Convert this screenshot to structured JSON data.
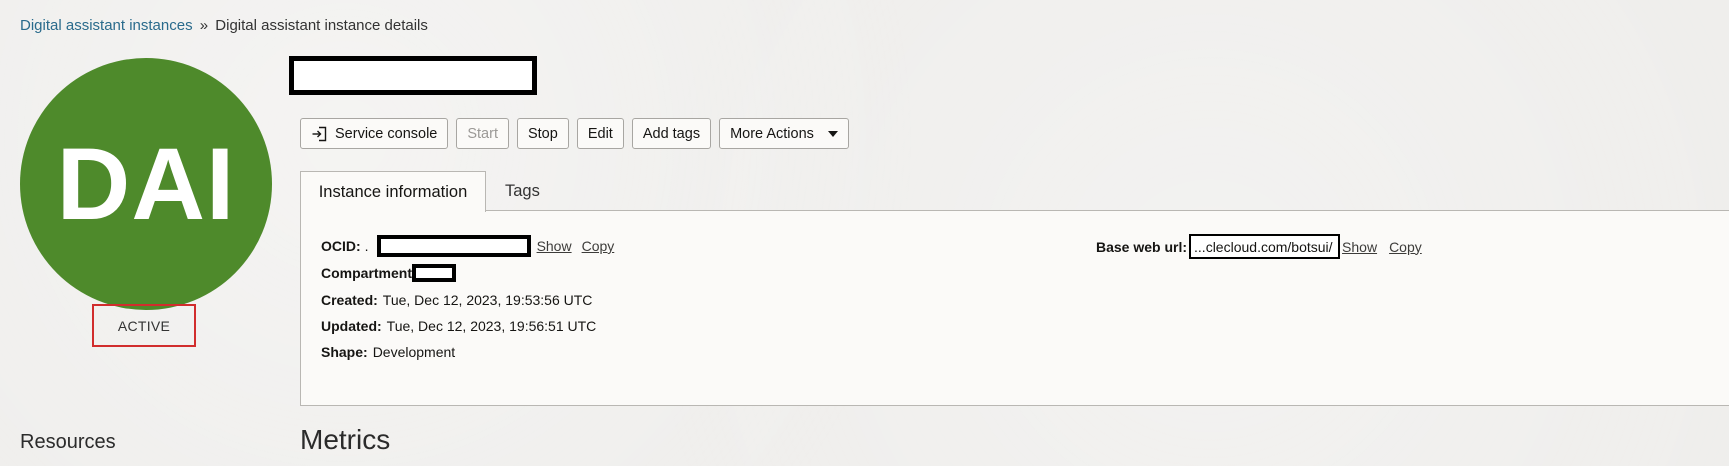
{
  "breadcrumb": {
    "parent": "Digital assistant instances",
    "separator": "»",
    "current": "Digital assistant instance details"
  },
  "avatar": {
    "initials": "DAI",
    "color": "#4e8a2b"
  },
  "status": {
    "label": "ACTIVE",
    "highlight_color": "#d12d2d"
  },
  "toolbar": {
    "service_console": "Service console",
    "start": "Start",
    "stop": "Stop",
    "edit": "Edit",
    "add_tags": "Add tags",
    "more_actions": "More Actions"
  },
  "tabs": {
    "instance_information": "Instance information",
    "tags": "Tags"
  },
  "details": {
    "ocid_label": "OCID:",
    "ocid_prefix": ".",
    "show": "Show",
    "copy": "Copy",
    "compartment_label": "Compartment",
    "created_label": "Created:",
    "created_value": "Tue, Dec 12, 2023, 19:53:56 UTC",
    "updated_label": "Updated:",
    "updated_value": "Tue, Dec 12, 2023, 19:56:51 UTC",
    "shape_label": "Shape:",
    "shape_value": "Development",
    "base_web_url_label": "Base web url:",
    "base_web_url_value": "...clecloud.com/botsui/"
  },
  "sections": {
    "resources": "Resources",
    "metrics": "Metrics"
  }
}
